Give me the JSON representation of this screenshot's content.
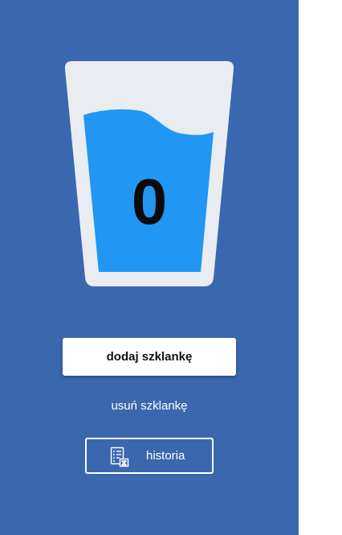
{
  "glass": {
    "count": "0"
  },
  "actions": {
    "add_label": "dodaj szklankę",
    "remove_label": "usuń szklankę",
    "history_label": "historia"
  },
  "icons": {
    "glass": "water-glass-icon",
    "history": "document-history-icon"
  },
  "colors": {
    "panel_background": "#3a68ae",
    "glass_body": "#e9ecf0",
    "water": "#2196f3",
    "page_background": "#ffffff"
  }
}
